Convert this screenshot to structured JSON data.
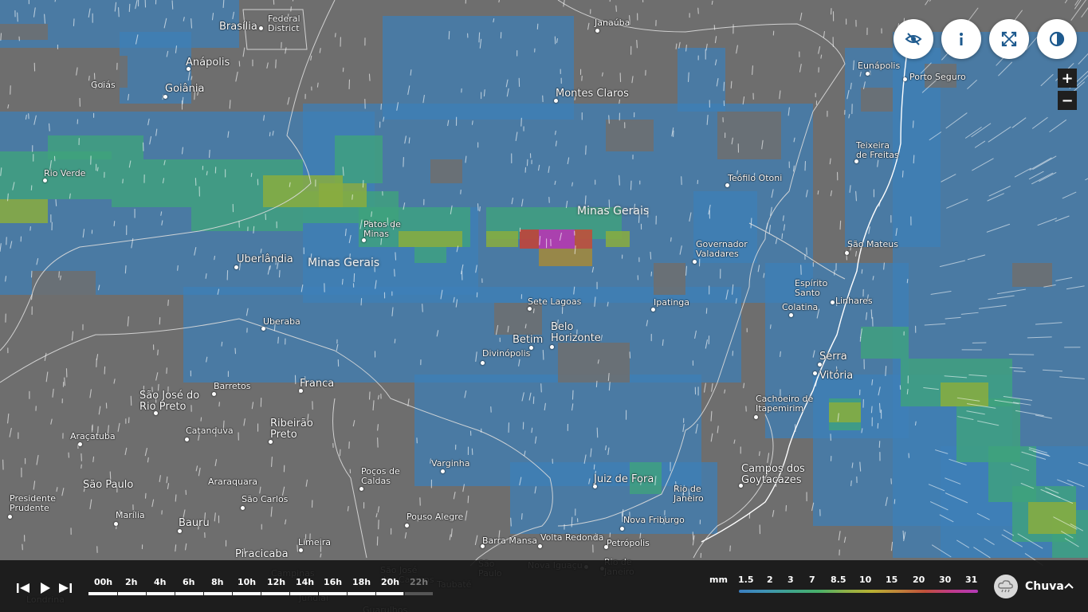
{
  "map": {
    "region_labels": [
      "Minas Gerais",
      "Minas Gerais"
    ],
    "cities": [
      {
        "name": "Brasília",
        "dot": true
      },
      {
        "name": "Federal\nDistrict",
        "dot": false
      },
      {
        "name": "Anápolis",
        "dot": true
      },
      {
        "name": "Goiás",
        "dot": false
      },
      {
        "name": "Goiânia",
        "dot": true
      },
      {
        "name": "Rio Verde",
        "dot": true
      },
      {
        "name": "Janaúba",
        "dot": true
      },
      {
        "name": "Montes Claros",
        "dot": true
      },
      {
        "name": "Eunápolis",
        "dot": true
      },
      {
        "name": "Porto Seguro",
        "dot": true
      },
      {
        "name": "Teixeira\nde Freitas",
        "dot": true
      },
      {
        "name": "Teófilo Otoni",
        "dot": true
      },
      {
        "name": "Patos de\nMinas",
        "dot": true
      },
      {
        "name": "Uberlândia",
        "dot": true
      },
      {
        "name": "Governador\nValadares",
        "dot": true
      },
      {
        "name": "São Mateus",
        "dot": true
      },
      {
        "name": "Espírito\nSanto",
        "dot": false
      },
      {
        "name": "Linhares",
        "dot": true
      },
      {
        "name": "Colatina",
        "dot": true
      },
      {
        "name": "Sete Lagoas",
        "dot": true
      },
      {
        "name": "Ipatinga",
        "dot": true
      },
      {
        "name": "Uberaba",
        "dot": true
      },
      {
        "name": "Betim",
        "dot": true
      },
      {
        "name": "Belo\nHorizonte",
        "dot": true
      },
      {
        "name": "Divinópolis",
        "dot": true
      },
      {
        "name": "Serra",
        "dot": true
      },
      {
        "name": "Vitória",
        "dot": true
      },
      {
        "name": "Barretos",
        "dot": true
      },
      {
        "name": "Franca",
        "dot": true
      },
      {
        "name": "São José do\nRio Preto",
        "dot": true
      },
      {
        "name": "Cachoeiro de\nItapemirim",
        "dot": true
      },
      {
        "name": "Araçatuba",
        "dot": true
      },
      {
        "name": "Catanduva",
        "dot": true
      },
      {
        "name": "Ribeirão\nPreto",
        "dot": true
      },
      {
        "name": "Varginha",
        "dot": true
      },
      {
        "name": "Campos dos\nGoytacazes",
        "dot": true
      },
      {
        "name": "Poços de\nCaldas",
        "dot": true
      },
      {
        "name": "Juiz de Fora",
        "dot": true
      },
      {
        "name": "Rio de\nJaneiro",
        "dot": false
      },
      {
        "name": "São Paulo",
        "dot": false
      },
      {
        "name": "Araraquara",
        "dot": false
      },
      {
        "name": "São Carlos",
        "dot": true
      },
      {
        "name": "Presidente\nPrudente",
        "dot": true
      },
      {
        "name": "Marília",
        "dot": true
      },
      {
        "name": "Bauru",
        "dot": true
      },
      {
        "name": "Pouso Alegre",
        "dot": true
      },
      {
        "name": "Nova Friburgo",
        "dot": true
      },
      {
        "name": "Barra Mansa",
        "dot": true
      },
      {
        "name": "Volta Redonda",
        "dot": true
      },
      {
        "name": "Petrópolis",
        "dot": true
      },
      {
        "name": "Limeira",
        "dot": true
      },
      {
        "name": "Piracicaba",
        "dot": false
      },
      {
        "name": "Campinas",
        "dot": false
      },
      {
        "name": "São José\ndos Campos",
        "dot": false
      },
      {
        "name": "Taubaté",
        "dot": false
      },
      {
        "name": "São\nPaulo",
        "dot": false
      },
      {
        "name": "Nova Iguaçu",
        "dot": true
      },
      {
        "name": "Rio de\nJaneiro",
        "dot": true
      },
      {
        "name": "Londrina",
        "dot": false
      },
      {
        "name": "Jundiaí",
        "dot": false
      },
      {
        "name": "Guarulhos",
        "dot": false
      }
    ]
  },
  "controls": [
    {
      "name": "hide-layer-button",
      "icon": "eye-slash-icon"
    },
    {
      "name": "info-button",
      "icon": "info-icon"
    },
    {
      "name": "fullscreen-button",
      "icon": "expand-icon"
    },
    {
      "name": "contrast-button",
      "icon": "contrast-icon"
    }
  ],
  "zoom": {
    "in_label": "+",
    "out_label": "−"
  },
  "timeline": {
    "labels": [
      "00h",
      "2h",
      "4h",
      "6h",
      "8h",
      "10h",
      "12h",
      "14h",
      "16h",
      "18h",
      "20h",
      "22h"
    ],
    "progress": 0.915
  },
  "legend": {
    "unit": "mm",
    "values": [
      "1.5",
      "2",
      "3",
      "7",
      "8.5",
      "10",
      "15",
      "20",
      "30",
      "31"
    ],
    "colors": [
      "#3a7ec0",
      "#3f93b4",
      "#3fa58a",
      "#48b06a",
      "#8db048",
      "#b8b032",
      "#c0843a",
      "#c0503a",
      "#c03a8a",
      "#b43ab8"
    ]
  },
  "layer": {
    "label": "Chuva",
    "icon": "rain-cloud-icon"
  },
  "colors": {
    "land": "#6e6e6e",
    "rain_light": "#3d7fb8",
    "rain_mid": "#3fa37c",
    "rain_high": "#8aad3e",
    "rain_peak": "#b03cb0",
    "bar": "#141414"
  }
}
